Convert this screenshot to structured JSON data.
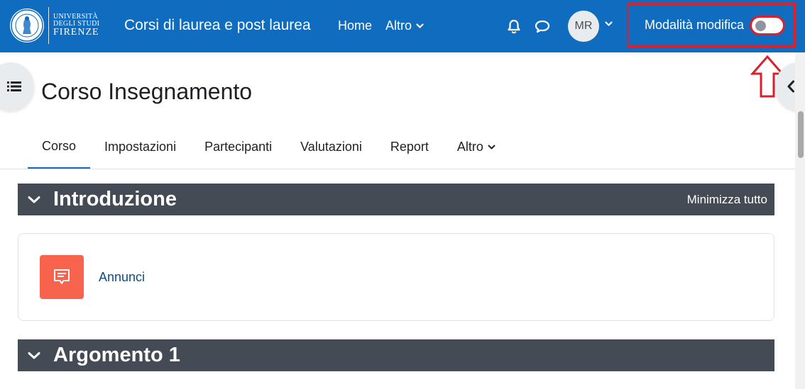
{
  "brand": {
    "university_line1": "UNIVERSITÀ",
    "university_line2": "DEGLI STUDI",
    "university_line3": "FIRENZE",
    "site_name": "Corsi di laurea e post laurea",
    "primary_color": "#0f6cbf"
  },
  "primary_nav": {
    "home": "Home",
    "more": "Altro"
  },
  "user": {
    "initials": "MR"
  },
  "edit_mode": {
    "label": "Modalità modifica",
    "enabled": false,
    "highlight_color": "#d9202b"
  },
  "icons": {
    "notifications": "bell-icon",
    "messages": "chat-bubble-icon",
    "course_index": "list-icon",
    "block_drawer": "chevron-left-icon",
    "announcements": "forum-icon"
  },
  "page": {
    "title": "Corso Insegnamento"
  },
  "secondary_nav": {
    "tabs": [
      {
        "label": "Corso",
        "active": true
      },
      {
        "label": "Impostazioni",
        "active": false
      },
      {
        "label": "Partecipanti",
        "active": false
      },
      {
        "label": "Valutazioni",
        "active": false
      },
      {
        "label": "Report",
        "active": false
      },
      {
        "label": "Altro",
        "active": false
      }
    ]
  },
  "course": {
    "collapse_all": "Minimizza tutto",
    "sections": [
      {
        "title": "Introduzione",
        "activities": [
          {
            "name": "Annunci",
            "color": "#f7634d"
          }
        ]
      },
      {
        "title": "Argomento 1",
        "activities": []
      }
    ],
    "section_bar_color": "#454b55"
  }
}
